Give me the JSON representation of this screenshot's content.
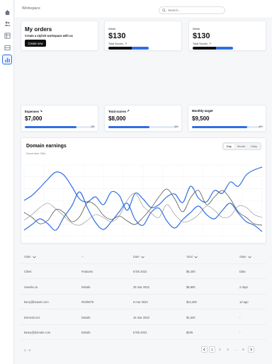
{
  "header": {
    "brand": "Workspace",
    "search_placeholder": "Search..."
  },
  "sidebar": {
    "items": [
      {
        "name": "home-icon"
      },
      {
        "name": "users-icon"
      },
      {
        "name": "table-icon"
      },
      {
        "name": "inbox-icon"
      },
      {
        "name": "bar-chart-icon",
        "active": true
      }
    ]
  },
  "orders_card": {
    "title": "My orders",
    "subtitle": "Create a stylish workspace with us",
    "button": "Create new"
  },
  "week_cards": [
    {
      "label": "Week",
      "value": "$130",
      "sub_label": "Total Scores",
      "arrow": "↗"
    },
    {
      "label": "Week",
      "value": "$130",
      "sub_label": "Total Scores",
      "arrow": "↗"
    }
  ],
  "metric_cards": [
    {
      "label": "Expenses",
      "arrow": "↘",
      "value": "$7,000",
      "percent_text": "3%",
      "progress": 0.75
    },
    {
      "label": "Total scores",
      "arrow": "↗",
      "value": "$8,000",
      "percent_text": "6%",
      "progress": 0.6
    },
    {
      "label": "Monthly target",
      "arrow": "",
      "value": "$9,500",
      "percent_text": "8%",
      "progress": 0.8
    }
  ],
  "earnings": {
    "title": "Domain earnings",
    "date": "December 30th,",
    "tabs": [
      "Day",
      "Month",
      "Daily"
    ],
    "active_tab": "Day"
  },
  "chart_data": {
    "type": "line",
    "x": [
      0,
      1,
      2,
      3,
      4,
      5,
      6,
      7,
      8,
      9,
      10,
      11,
      12,
      13,
      14,
      15,
      16,
      17,
      18,
      19,
      20,
      21,
      22,
      23,
      24,
      25,
      26,
      27,
      28,
      29,
      30
    ],
    "ylim": [
      0,
      100
    ],
    "grid": true,
    "colors": [
      "#2f6fe4",
      "#2f6fe4",
      "#555555",
      "#888888"
    ],
    "series": [
      {
        "values": [
          50,
          57,
          68,
          80,
          90,
          86,
          70,
          52,
          48,
          55,
          44,
          62,
          57,
          36,
          60,
          52,
          40,
          44,
          55,
          59,
          47,
          70,
          53,
          48,
          64,
          60,
          76,
          70,
          86,
          93,
          97
        ]
      },
      {
        "values": [
          8,
          16,
          24,
          17,
          8,
          26,
          42,
          62,
          39,
          19,
          9,
          20,
          34,
          46,
          23,
          15,
          33,
          39,
          21,
          11,
          23,
          33,
          42,
          30,
          24,
          36,
          46,
          32,
          20,
          15,
          6
        ]
      },
      {
        "values": [
          33,
          26,
          17,
          22,
          37,
          33,
          20,
          27,
          47,
          43,
          29,
          23,
          28,
          21,
          16,
          26,
          39,
          55,
          66,
          52,
          34,
          54,
          64,
          44,
          55,
          64,
          52,
          34,
          26,
          17,
          15
        ]
      },
      {
        "values": [
          22,
          30,
          40,
          46,
          38,
          28,
          18,
          15,
          22,
          30,
          26,
          20,
          28,
          50,
          60,
          42,
          32,
          26,
          44,
          30,
          20,
          22,
          30,
          42,
          36,
          26,
          28,
          42,
          40,
          30,
          26
        ]
      }
    ]
  },
  "table": {
    "columns": [
      "State",
      "--",
      "Date",
      "Total",
      "State"
    ],
    "rows": [
      [
        "Client",
        "Features",
        "8 feb 2022",
        "$6,200",
        "Date"
      ],
      [
        "ravenko.tu",
        "Details",
        "25 mar 2022",
        "$9,800",
        "2 days"
      ],
      [
        "kerry@beaute.com",
        "#04/5078",
        "6 mar 2023",
        "$12,300",
        "1d ago"
      ],
      [
        "Domeini.net",
        "Details",
        "16 mar 2022",
        "$1,520",
        "-"
      ],
      [
        "kasey@domain.com",
        "Details",
        "8 feb 2022",
        "$105",
        "-"
      ]
    ]
  },
  "pagination": {
    "info": "1 - 4",
    "pages": [
      "1",
      "2",
      "3",
      "...",
      "8"
    ],
    "current": "1"
  }
}
